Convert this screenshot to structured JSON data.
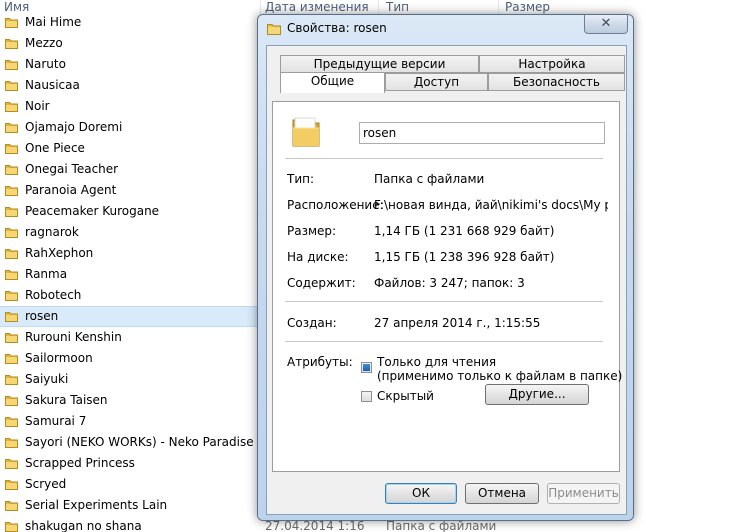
{
  "explorer": {
    "columns": {
      "name": "Имя",
      "date": "Дата изменения",
      "type": "Тип",
      "size": "Размер"
    },
    "files": [
      "Mai Hime",
      "Mezzo",
      "Naruto",
      "Nausicaa",
      "Noir",
      "Ojamajo Doremi",
      "One Piece",
      "Onegai Teacher",
      "Paranoia Agent",
      "Peacemaker Kurogane",
      "ragnarok",
      "RahXephon",
      "Ranma",
      "Robotech",
      "rosen",
      "Rurouni Kenshin",
      "Sailormoon",
      "Saiyuki",
      "Sakura Taisen",
      "Samurai 7",
      "Sayori (NEKO WORKs) - Neko Paradise",
      "Scrapped Princess",
      "Scryed",
      "Serial Experiments Lain",
      "shakugan no shana"
    ],
    "selected_file": "rosen",
    "bottom_row": {
      "date": "27.04.2014 1:16",
      "type": "Папка с файлами"
    }
  },
  "dialog": {
    "title": "Свойства: rosen",
    "close_symbol": "✕",
    "tabs": {
      "previous_versions": "Предыдущие версии",
      "customize": "Настройка",
      "general": "Общие",
      "sharing": "Доступ",
      "security": "Безопасность"
    },
    "folder_name": "rosen",
    "properties": {
      "type_label": "Тип:",
      "type_value": "Папка с файлами",
      "location_label": "Расположение:",
      "location_value": "F:\\новая винда, йай\\nikimi's docs\\My pictures\\A",
      "size_label": "Размер:",
      "size_value": "1,14 ГБ (1 231 668 929 байт)",
      "disk_label": "На диске:",
      "disk_value": "1,15 ГБ (1 238 396 928 байт)",
      "contains_label": "Содержит:",
      "contains_value": "Файлов: 3 247; папок: 3",
      "created_label": "Создан:",
      "created_value": "27 апреля 2014 г., 1:15:55",
      "attributes_label": "Атрибуты:",
      "readonly_label": "Только для чтения",
      "readonly_note": "(применимо только к файлам в папке)",
      "hidden_label": "Скрытый",
      "other_button": "Другие..."
    },
    "buttons": {
      "ok": "ОК",
      "cancel": "Отмена",
      "apply": "Применить"
    }
  }
}
